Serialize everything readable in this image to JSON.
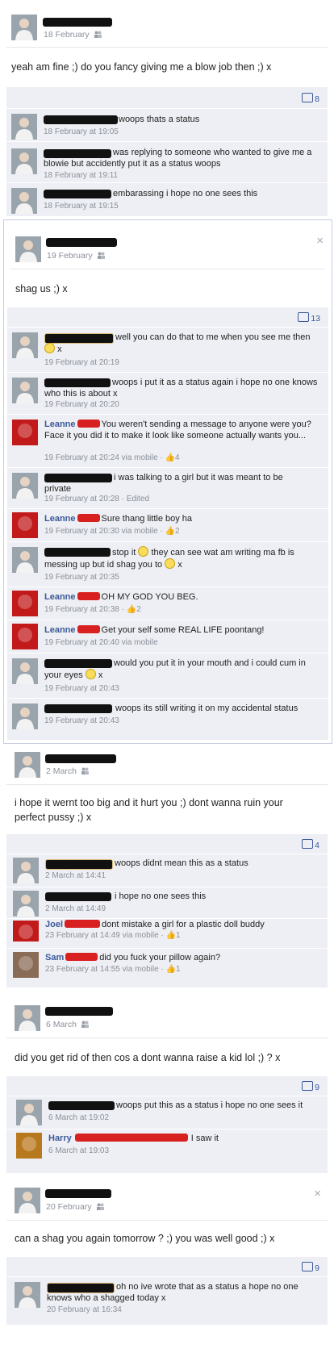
{
  "colors": {
    "link": "#3b5998",
    "meta": "#8a8f99",
    "comment_bg": "#edeff4",
    "redaction_black": "#111111",
    "redaction_red": "#d92020"
  },
  "posts": [
    {
      "date": "18 February",
      "status": "yeah am fine ;) do you fancy giving me a blow job then ;) x",
      "comment_count": "8",
      "comments": [
        {
          "text": "woops thats a status",
          "time": "18 February at 19:05"
        },
        {
          "text": "was replying to someone who wanted to give me a blowie but accidently put it as a status woops",
          "time": "18 February at 19:11"
        },
        {
          "text": "embarassing i hope no one sees this",
          "time": "18 February at 19:15"
        }
      ]
    },
    {
      "date": "19 February",
      "status": "shag us ;) x",
      "comment_count": "13",
      "close": "×",
      "comments": [
        {
          "text": "well you can do that to me when you see me then",
          "text2": "x",
          "time": "19 February at 20:19"
        },
        {
          "text": "woops i put it as a status again i hope no one knows who this is about x",
          "time": "19 February at 20:20"
        },
        {
          "name": "Leanne",
          "text": "You weren't sending a message to anyone were you? Face it you did it to make it look like someone actually wants you...",
          "time": "19 February at 20:24 via mobile · ",
          "likes": "4"
        },
        {
          "text": "i was talking to a girl but it was meant to be private",
          "time": "19 February at 20:28 · Edited"
        },
        {
          "name": "Leanne",
          "text": "Sure thang little boy ha",
          "time": "19 February at 20:30 via mobile · ",
          "likes": "2"
        },
        {
          "text": "stop it",
          "text2": "they can see wat am writing ma fb is messing up but id shag you to",
          "text3": "x",
          "time": "19 February at 20:35"
        },
        {
          "name": "Leanne",
          "text": "OH MY GOD YOU BEG.",
          "time": "19 February at 20:38 · ",
          "likes": "2"
        },
        {
          "name": "Leanne",
          "text": "Get your self some REAL LIFE poontang!",
          "time": "19 February at 20:40 via mobile"
        },
        {
          "text": "would you put it in your mouth and i could cum in your eyes",
          "text2": "x",
          "time": "19 February at 20:43"
        },
        {
          "text": "woops its still writing it on my accidental status",
          "time": "19 February at 20:43"
        }
      ]
    },
    {
      "date": "2 March",
      "status": "i hope it wernt too big and it hurt you ;) dont wanna ruin your perfect pussy ;) x",
      "comment_count": "4",
      "comments": [
        {
          "text": "woops didnt mean this as a status",
          "time": "2 March at 14:41"
        },
        {
          "text": "i hope no one sees this",
          "time": "2 March at 14:49"
        },
        {
          "name": "Joel",
          "text": "dont mistake a girl for a plastic doll buddy",
          "time": "23 February at 14:49 via mobile · ",
          "likes": "1"
        },
        {
          "name": "Sam",
          "text": "did you fuck your pillow again?",
          "time": "23 February at 14:55 via mobile · ",
          "likes": "1"
        }
      ]
    },
    {
      "date": "6 March",
      "status": "did you get rid of then cos a dont wanna raise a kid lol ;) ? x",
      "comment_count": "9",
      "comments": [
        {
          "text": "woops put this as a status i hope no one sees it",
          "time": "6 March at 19:02"
        },
        {
          "name": "Harry",
          "text": "I saw it",
          "time": "6 March at 19:03"
        }
      ]
    },
    {
      "date": "20 February",
      "status": "can a shag you again tomorrow ? ;) you was well good ;) x",
      "comment_count": "9",
      "close": "×",
      "comments": [
        {
          "text": "oh no ive wrote that as a status a hope no one knows who a shagged today x",
          "time": "20 February at 16:34"
        }
      ]
    }
  ]
}
